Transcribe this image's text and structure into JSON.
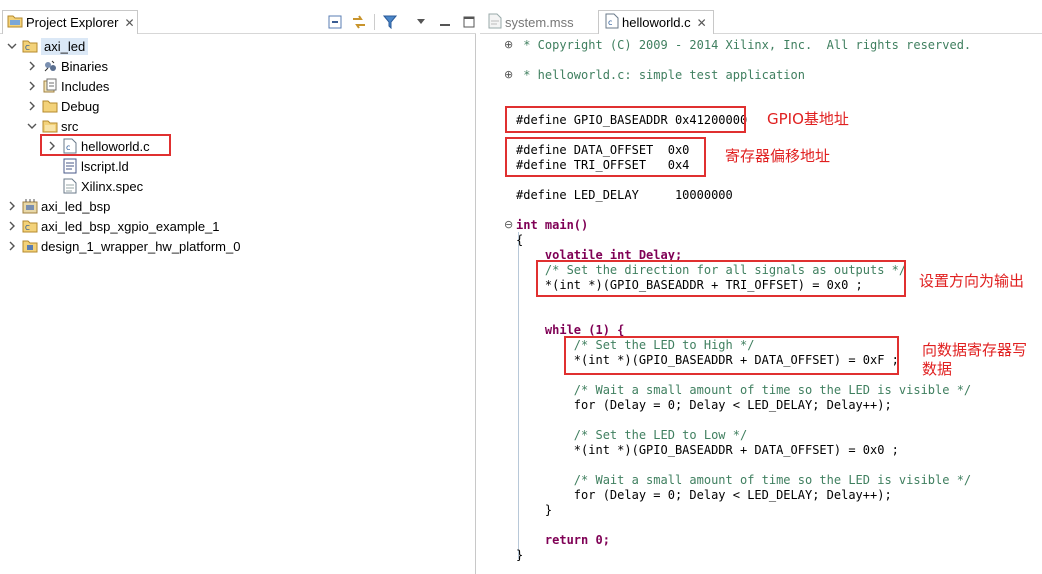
{
  "explorer": {
    "tab_label": "Project Explorer",
    "tab_close": "✕",
    "tree": [
      {
        "label": "axi_led"
      },
      {
        "label": "Binaries"
      },
      {
        "label": "Includes"
      },
      {
        "label": "Debug"
      },
      {
        "label": "src"
      },
      {
        "label": "helloworld.c"
      },
      {
        "label": "lscript.ld"
      },
      {
        "label": "Xilinx.spec"
      },
      {
        "label": "axi_led_bsp"
      },
      {
        "label": "axi_led_bsp_xgpio_example_1"
      },
      {
        "label": "design_1_wrapper_hw_platform_0"
      }
    ]
  },
  "editor": {
    "tabs": [
      {
        "label": "system.mss"
      },
      {
        "label": "helloworld.c",
        "close": "✕"
      }
    ],
    "code": [
      " * Copyright (C) 2009 - 2014 Xilinx, Inc.  All rights reserved.",
      " * helloworld.c: simple test application",
      "#define GPIO_BASEADDR 0x41200000",
      "#define DATA_OFFSET  0x0",
      "#define TRI_OFFSET   0x4",
      "#define LED_DELAY     10000000",
      "int main()",
      "{",
      "    volatile int Delay;",
      "    /* Set the direction for all signals as outputs */",
      "    *(int *)(GPIO_BASEADDR + TRI_OFFSET) = 0x0 ;",
      "    while (1) {",
      "        /* Set the LED to High */",
      "        *(int *)(GPIO_BASEADDR + DATA_OFFSET) = 0xF ;",
      "        /* Wait a small amount of time so the LED is visible */",
      "        for (Delay = 0; Delay < LED_DELAY; Delay++);",
      "        /* Set the LED to Low */",
      "        *(int *)(GPIO_BASEADDR + DATA_OFFSET) = 0x0 ;",
      "        /* Wait a small amount of time so the LED is visible */",
      "        for (Delay = 0; Delay < LED_DELAY; Delay++);",
      "    }",
      "    return 0;",
      "}"
    ]
  },
  "annotations": {
    "gpio_base": "GPIO基地址",
    "reg_offset": "寄存器偏移地址",
    "set_direction": "设置方向为输出",
    "write_data_1": "向数据寄存器写",
    "write_data_2": "数据"
  },
  "colors": {
    "annotation_red": "#e03030",
    "comment_green": "#3f7f5f",
    "keyword_purple": "#7f0055",
    "selection_blue": "#dbe8f6"
  }
}
